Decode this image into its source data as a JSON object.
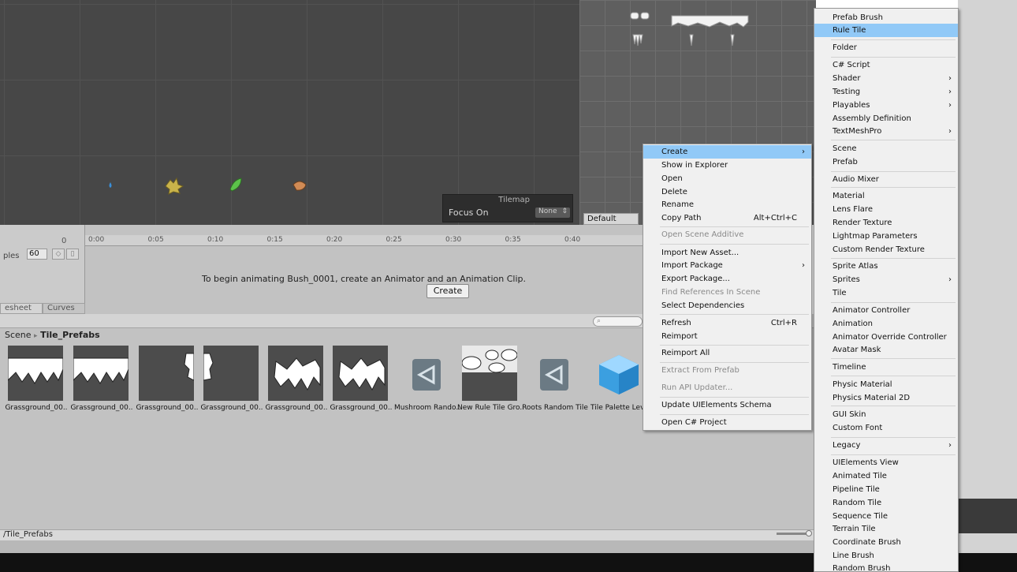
{
  "scene": {
    "tilemap_overlay": {
      "title": "Tilemap",
      "focus_label": "Focus On",
      "focus_value": "None"
    },
    "default_brush": "Default Brush"
  },
  "animation": {
    "frame": "0",
    "samples_label": "ples",
    "samples_value": "60",
    "ticks": [
      "0:00",
      "0:05",
      "0:10",
      "0:15",
      "0:20",
      "0:25",
      "0:30",
      "0:35",
      "0:40"
    ],
    "message": "To begin animating Bush_0001, create an Animator and an Animation Clip.",
    "create_label": "Create",
    "tabs": [
      "esheet",
      "Curves"
    ]
  },
  "project": {
    "breadcrumb_root": "Scene",
    "breadcrumb_sep": "▸",
    "breadcrumb_current": "Tile_Prefabs",
    "footer_path": "/Tile_Prefabs",
    "assets": [
      {
        "label": "Grassground_00..",
        "kind": "grass-full"
      },
      {
        "label": "Grassground_00..",
        "kind": "grass-full"
      },
      {
        "label": "Grassground_00..",
        "kind": "grass-right-edge"
      },
      {
        "label": "Grassground_00..",
        "kind": "grass-left-edge"
      },
      {
        "label": "Grassground_00..",
        "kind": "grass-peaks"
      },
      {
        "label": "Grassground_00..",
        "kind": "grass-peaks"
      },
      {
        "label": "Mushroom Rando..",
        "kind": "unity-asset"
      },
      {
        "label": "New Rule Tile Gro..",
        "kind": "rule-tile"
      },
      {
        "label": "Roots Random Tile",
        "kind": "unity-asset"
      },
      {
        "label": "Tile Palette Leve",
        "kind": "cube"
      }
    ]
  },
  "context_menu": {
    "items": [
      {
        "label": "Create",
        "highlighted": true,
        "submenu": true
      },
      {
        "label": "Show in Explorer"
      },
      {
        "label": "Open"
      },
      {
        "label": "Delete"
      },
      {
        "label": "Rename"
      },
      {
        "label": "Copy Path",
        "shortcut": "Alt+Ctrl+C"
      },
      {
        "label": "Open Scene Additive",
        "disabled": true
      },
      {
        "label": "Import New Asset..."
      },
      {
        "label": "Import Package",
        "submenu": true
      },
      {
        "label": "Export Package..."
      },
      {
        "label": "Find References In Scene",
        "disabled": true
      },
      {
        "label": "Select Dependencies"
      },
      {
        "label": "Refresh",
        "shortcut": "Ctrl+R"
      },
      {
        "label": "Reimport"
      },
      {
        "label": "Reimport All"
      },
      {
        "label": "Extract From Prefab",
        "disabled": true
      },
      {
        "label": "Run API Updater...",
        "disabled": true
      },
      {
        "label": "Update UIElements Schema"
      },
      {
        "label": "Open C# Project"
      }
    ]
  },
  "create_submenu": {
    "items": [
      {
        "label": "Prefab Brush"
      },
      {
        "label": "Rule Tile",
        "highlighted": true
      },
      {
        "label": "Folder"
      },
      {
        "label": "C# Script"
      },
      {
        "label": "Shader",
        "submenu": true
      },
      {
        "label": "Testing",
        "submenu": true
      },
      {
        "label": "Playables",
        "submenu": true
      },
      {
        "label": "Assembly Definition"
      },
      {
        "label": "TextMeshPro",
        "submenu": true
      },
      {
        "label": "Scene"
      },
      {
        "label": "Prefab"
      },
      {
        "label": "Audio Mixer"
      },
      {
        "label": "Material"
      },
      {
        "label": "Lens Flare"
      },
      {
        "label": "Render Texture"
      },
      {
        "label": "Lightmap Parameters"
      },
      {
        "label": "Custom Render Texture"
      },
      {
        "label": "Sprite Atlas"
      },
      {
        "label": "Sprites",
        "submenu": true
      },
      {
        "label": "Tile"
      },
      {
        "label": "Animator Controller"
      },
      {
        "label": "Animation"
      },
      {
        "label": "Animator Override Controller"
      },
      {
        "label": "Avatar Mask"
      },
      {
        "label": "Timeline"
      },
      {
        "label": "Physic Material"
      },
      {
        "label": "Physics Material 2D"
      },
      {
        "label": "GUI Skin"
      },
      {
        "label": "Custom Font"
      },
      {
        "label": "Legacy",
        "submenu": true
      },
      {
        "label": "UIElements View"
      },
      {
        "label": "Animated Tile"
      },
      {
        "label": "Pipeline Tile"
      },
      {
        "label": "Random Tile"
      },
      {
        "label": "Sequence Tile"
      },
      {
        "label": "Terrain Tile"
      },
      {
        "label": "Coordinate Brush"
      },
      {
        "label": "Line Brush"
      },
      {
        "label": "Random Brush"
      }
    ]
  },
  "colors": {
    "menu_highlight": "#91c9f7",
    "scene_bg": "#474747",
    "panel_bg": "#c2c2c2"
  }
}
